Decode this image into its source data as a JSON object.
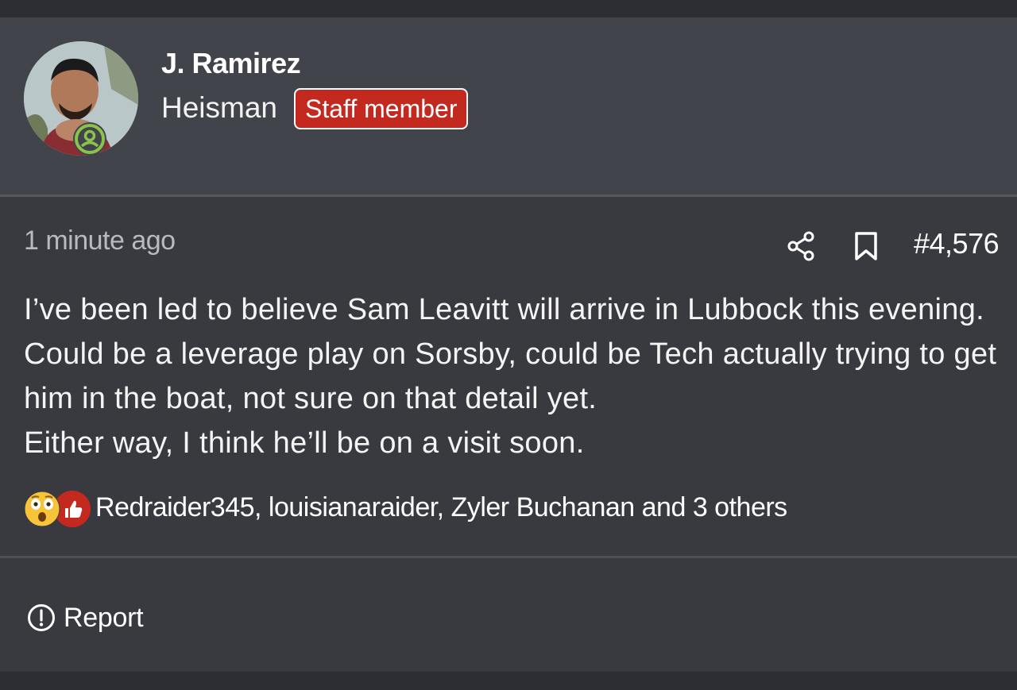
{
  "author": {
    "name": "J. Ramirez",
    "title": "Heisman",
    "badge": "Staff member",
    "avatar_icon": "user-avatar-photo",
    "status_icon": "online-user-icon"
  },
  "post": {
    "timestamp": "1 minute ago",
    "number": "#4,576",
    "share_icon": "share-icon",
    "bookmark_icon": "bookmark-icon",
    "message": [
      "I’ve been led to believe Sam Leavitt will arrive in Lubbock this evening. Could be a leverage play on Sorsby, could be Tech actually trying to get him in the boat, not sure on that detail yet.",
      "Either way, I think he’ll be on a visit soon."
    ]
  },
  "reactions": {
    "icons": [
      "wow-emoji-icon",
      "thumbs-up-icon"
    ],
    "summary": "Redraider345, louisianaraider, Zyler Buchanan and 3 others"
  },
  "actions": {
    "report_label": "Report",
    "report_icon": "alert-circle-icon"
  },
  "colors": {
    "background": "#2c2e33",
    "user_block": "#42444b",
    "post_body": "#383a40",
    "staff_badge": "#c4291f",
    "online_status": "#8bc34a"
  }
}
